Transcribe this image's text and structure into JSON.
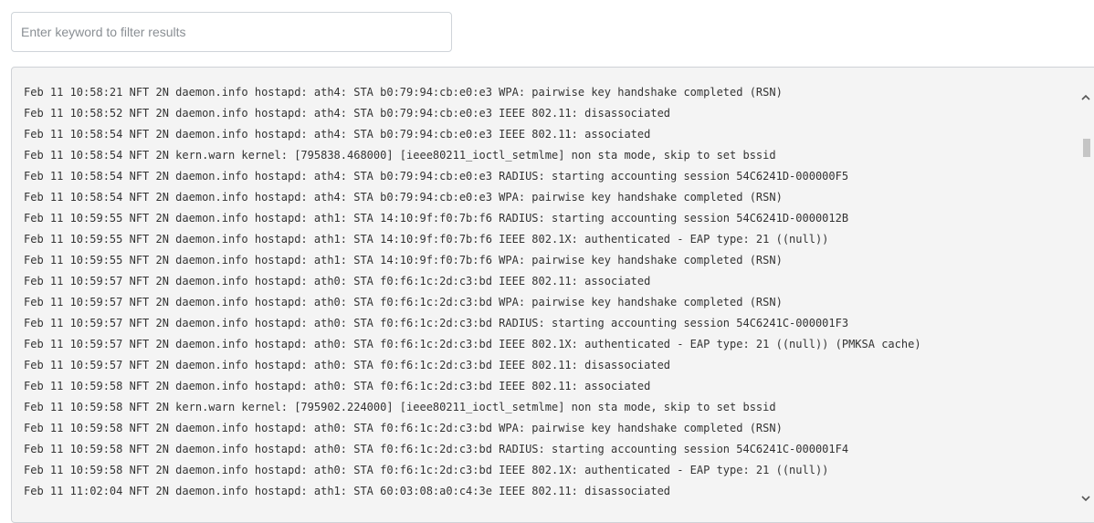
{
  "filter": {
    "placeholder": "Enter keyword to filter results",
    "value": ""
  },
  "log": {
    "lines": [
      "Feb 11 10:58:21 NFT 2N daemon.info hostapd: ath4: STA b0:79:94:cb:e0:e3 WPA: pairwise key handshake completed (RSN)",
      "Feb 11 10:58:52 NFT 2N daemon.info hostapd: ath4: STA b0:79:94:cb:e0:e3 IEEE 802.11: disassociated",
      "Feb 11 10:58:54 NFT 2N daemon.info hostapd: ath4: STA b0:79:94:cb:e0:e3 IEEE 802.11: associated",
      "Feb 11 10:58:54 NFT 2N kern.warn kernel: [795838.468000] [ieee80211_ioctl_setmlme] non sta mode, skip to set bssid",
      "Feb 11 10:58:54 NFT 2N daemon.info hostapd: ath4: STA b0:79:94:cb:e0:e3 RADIUS: starting accounting session 54C6241D-000000F5",
      "Feb 11 10:58:54 NFT 2N daemon.info hostapd: ath4: STA b0:79:94:cb:e0:e3 WPA: pairwise key handshake completed (RSN)",
      "Feb 11 10:59:55 NFT 2N daemon.info hostapd: ath1: STA 14:10:9f:f0:7b:f6 RADIUS: starting accounting session 54C6241D-0000012B",
      "Feb 11 10:59:55 NFT 2N daemon.info hostapd: ath1: STA 14:10:9f:f0:7b:f6 IEEE 802.1X: authenticated - EAP type: 21 ((null))",
      "Feb 11 10:59:55 NFT 2N daemon.info hostapd: ath1: STA 14:10:9f:f0:7b:f6 WPA: pairwise key handshake completed (RSN)",
      "Feb 11 10:59:57 NFT 2N daemon.info hostapd: ath0: STA f0:f6:1c:2d:c3:bd IEEE 802.11: associated",
      "Feb 11 10:59:57 NFT 2N daemon.info hostapd: ath0: STA f0:f6:1c:2d:c3:bd WPA: pairwise key handshake completed (RSN)",
      "Feb 11 10:59:57 NFT 2N daemon.info hostapd: ath0: STA f0:f6:1c:2d:c3:bd RADIUS: starting accounting session 54C6241C-000001F3",
      "Feb 11 10:59:57 NFT 2N daemon.info hostapd: ath0: STA f0:f6:1c:2d:c3:bd IEEE 802.1X: authenticated - EAP type: 21 ((null)) (PMKSA cache)",
      "Feb 11 10:59:57 NFT 2N daemon.info hostapd: ath0: STA f0:f6:1c:2d:c3:bd IEEE 802.11: disassociated",
      "Feb 11 10:59:58 NFT 2N daemon.info hostapd: ath0: STA f0:f6:1c:2d:c3:bd IEEE 802.11: associated",
      "Feb 11 10:59:58 NFT 2N kern.warn kernel: [795902.224000] [ieee80211_ioctl_setmlme] non sta mode, skip to set bssid",
      "Feb 11 10:59:58 NFT 2N daemon.info hostapd: ath0: STA f0:f6:1c:2d:c3:bd WPA: pairwise key handshake completed (RSN)",
      "Feb 11 10:59:58 NFT 2N daemon.info hostapd: ath0: STA f0:f6:1c:2d:c3:bd RADIUS: starting accounting session 54C6241C-000001F4",
      "Feb 11 10:59:58 NFT 2N daemon.info hostapd: ath0: STA f0:f6:1c:2d:c3:bd IEEE 802.1X: authenticated - EAP type: 21 ((null))",
      "Feb 11 11:02:04 NFT 2N daemon.info hostapd: ath1: STA 60:03:08:a0:c4:3e IEEE 802.11: disassociated"
    ]
  },
  "scrollbar": {
    "up_icon": "chevron-up-icon",
    "down_icon": "chevron-down-icon",
    "thumb_color": "#c5c5c5"
  }
}
